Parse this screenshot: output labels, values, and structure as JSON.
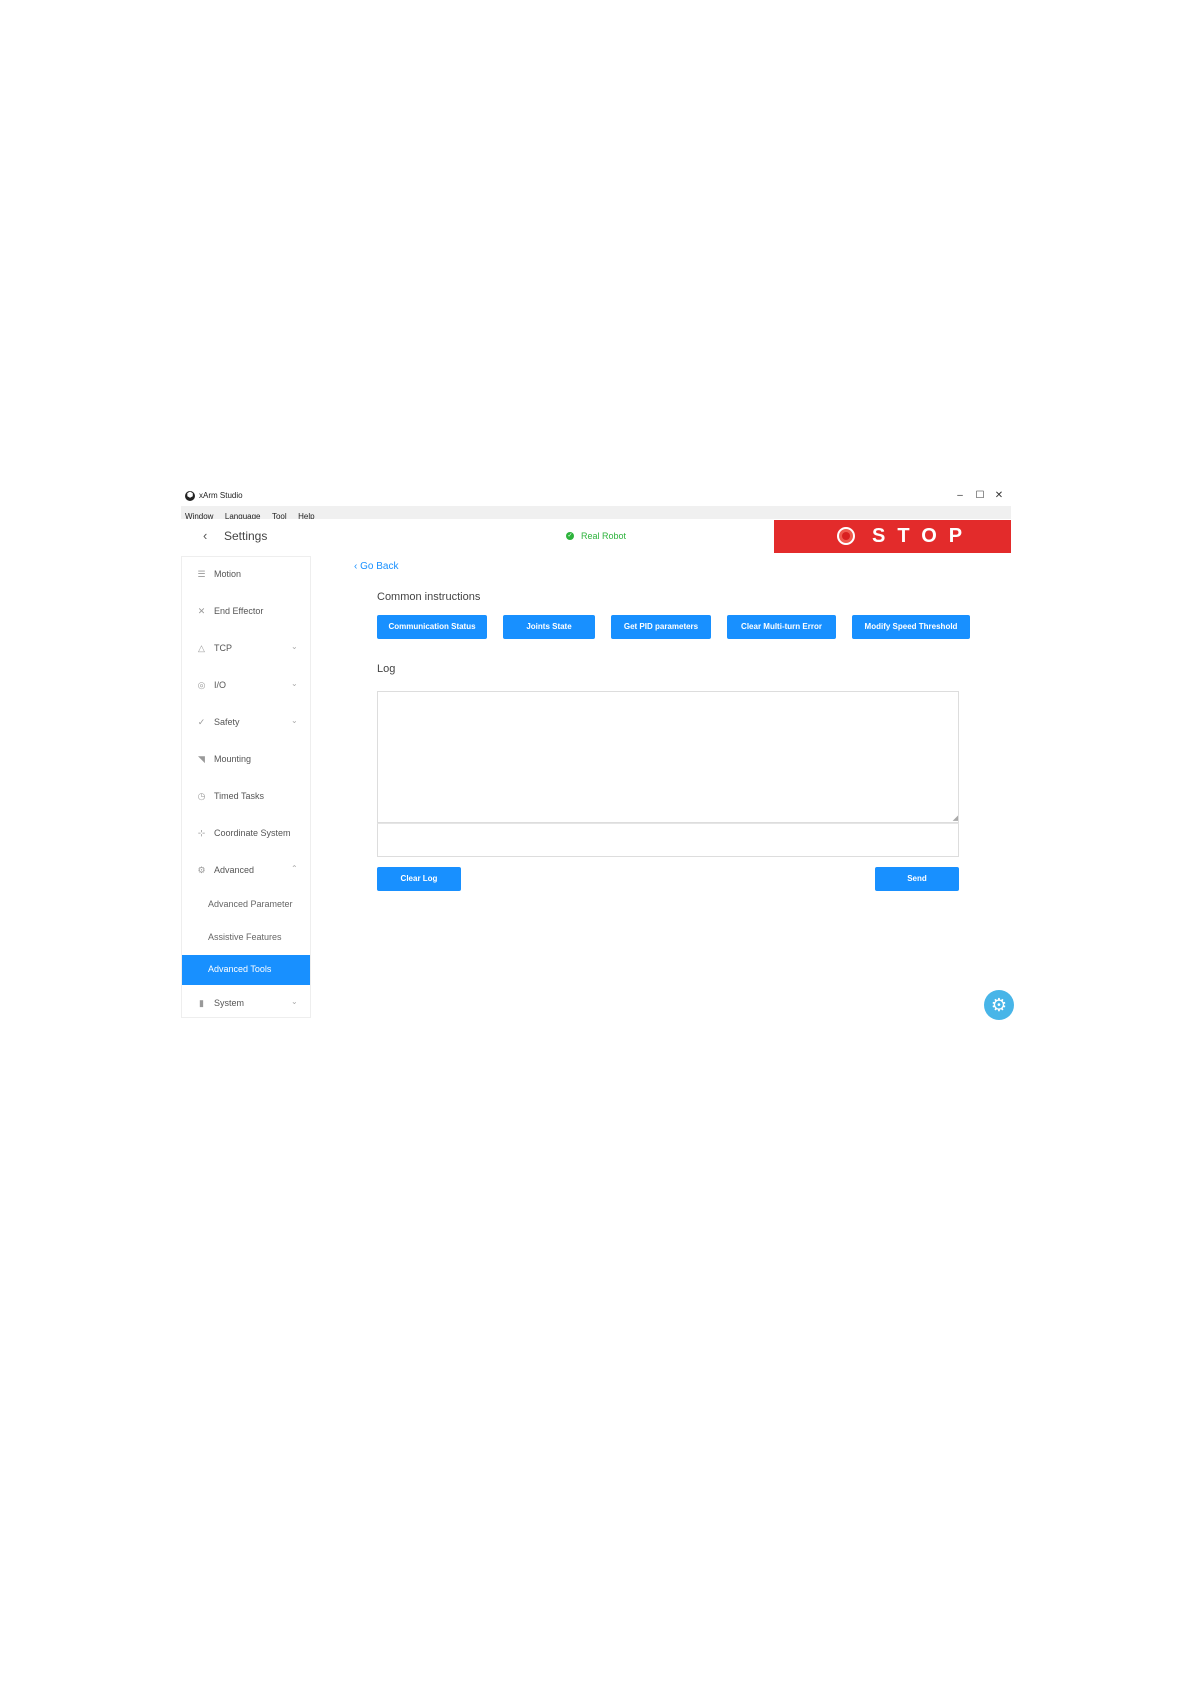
{
  "window": {
    "title": "xArm Studio",
    "controls": {
      "minimize": "–",
      "maximize": "☐",
      "close": "✕"
    }
  },
  "menubar": {
    "items": [
      "Window",
      "Language",
      "Tool",
      "Help"
    ]
  },
  "header": {
    "back_icon": "‹",
    "title": "Settings",
    "status_text": "Real Robot",
    "status_color": "#2db33c",
    "stop_label": "STOP",
    "stop_color": "#e32b2b"
  },
  "sidebar": {
    "items": [
      {
        "label": "Motion",
        "icon": "motion-icon"
      },
      {
        "label": "End Effector",
        "icon": "end-effector-icon"
      },
      {
        "label": "TCP",
        "icon": "tcp-icon"
      },
      {
        "label": "I/O",
        "icon": "io-icon"
      },
      {
        "label": "Safety",
        "icon": "safety-icon"
      },
      {
        "label": "Mounting",
        "icon": "mounting-icon"
      },
      {
        "label": "Timed Tasks",
        "icon": "timed-tasks-icon"
      },
      {
        "label": "Coordinate System",
        "icon": "coordinate-system-icon"
      },
      {
        "label": "Advanced",
        "icon": "advanced-icon"
      }
    ],
    "advanced_sub": [
      "Advanced Parameter",
      "Assistive Features",
      "Advanced Tools"
    ],
    "system": {
      "label": "System",
      "icon": "system-icon"
    },
    "accent_color": "#1890ff"
  },
  "main": {
    "go_back": "Go Back",
    "common_title": "Common instructions",
    "common_buttons": [
      "Communication Status",
      "Joints State",
      "Get PID parameters",
      "Clear Multi-turn Error",
      "Modify Speed Threshold"
    ],
    "log_title": "Log",
    "log_value": "",
    "command_value": "",
    "clear_log": "Clear Log",
    "send": "Send"
  }
}
